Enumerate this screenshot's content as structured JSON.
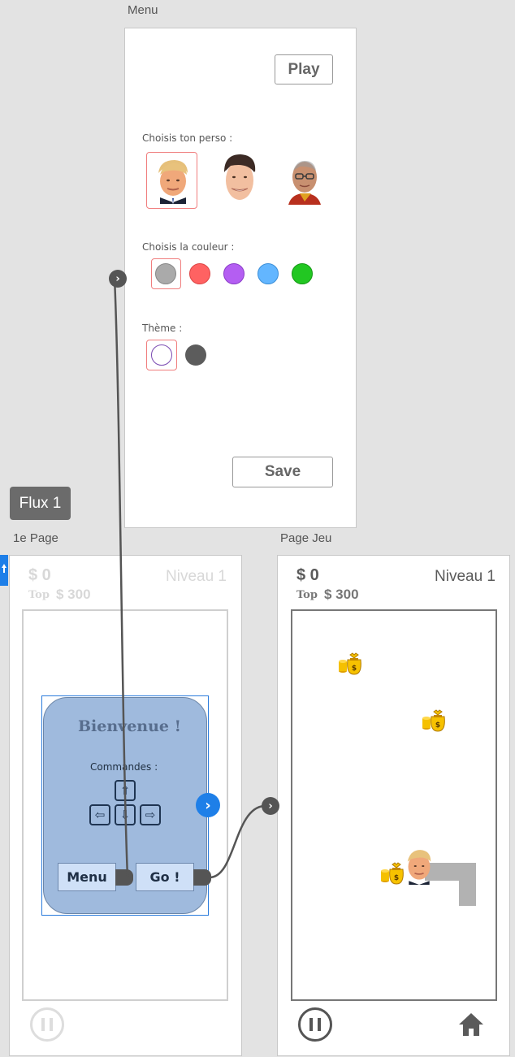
{
  "labels": {
    "menu_screen": "Menu",
    "first_page_screen": "1e Page",
    "game_screen": "Page Jeu",
    "flow_tag": "Flux 1"
  },
  "menu": {
    "play_label": "Play",
    "character_label": "Choisis ton perso :",
    "color_label": "Choisis la couleur :",
    "theme_label": "Thème :",
    "save_label": "Save",
    "characters": [
      "character-1",
      "character-2",
      "character-3"
    ],
    "colors": [
      "#aaaaaa",
      "#ff6262",
      "#b45ef2",
      "#63b6ff",
      "#22c722"
    ],
    "themes": [
      "#ffffff",
      "#5c5c5c"
    ],
    "selected_character": 0,
    "selected_color": 0,
    "selected_theme": 0
  },
  "first_page": {
    "money": "$ 0",
    "top_label": "Top",
    "top_value": "$ 300",
    "level": "Niveau 1",
    "welcome_title": "Bienvenue !",
    "commands_label": "Commandes :",
    "menu_button": "Menu",
    "go_button": "Go !"
  },
  "game_page": {
    "money": "$ 0",
    "top_label": "Top",
    "top_value": "$ 300",
    "level": "Niveau 1"
  },
  "icons": {
    "up": "⇧",
    "left": "⇦",
    "down": "⇩",
    "right": "⇨",
    "next": "›",
    "home": "home-icon"
  }
}
